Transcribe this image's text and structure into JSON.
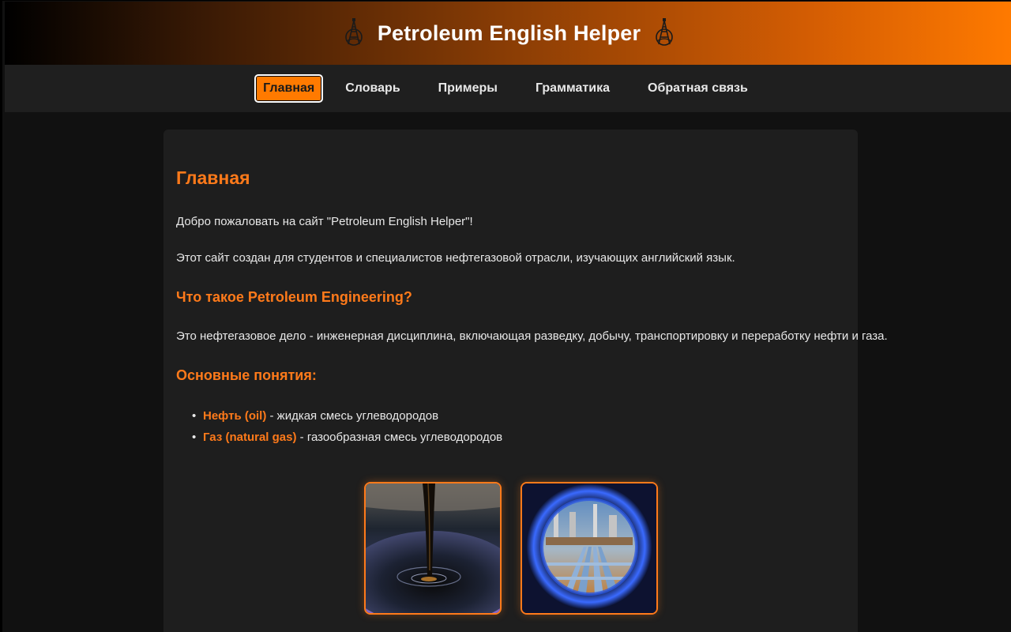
{
  "header": {
    "title": "Petroleum English Helper",
    "left_icon": "oil-rig-icon",
    "right_icon": "oil-rig-icon"
  },
  "nav": {
    "items": [
      {
        "label": "Главная",
        "active": true
      },
      {
        "label": "Словарь",
        "active": false
      },
      {
        "label": "Примеры",
        "active": false
      },
      {
        "label": "Грамматика",
        "active": false
      },
      {
        "label": "Обратная связь",
        "active": false
      }
    ]
  },
  "main": {
    "heading": "Главная",
    "welcome": "Добро пожаловать на сайт \"Petroleum English Helper\"!",
    "intro": "Этот сайт создан для студентов и специалистов нефтегазовой отрасли, изучающих английский язык.",
    "what_is_heading": "Что такое Petroleum Engineering?",
    "what_is_text": "Это нефтегазовое дело - инженерная дисциплина, включающая разведку, добычу, транспортировку и переработку нефти и газа.",
    "concepts_heading": "Основные понятия:",
    "concepts": [
      {
        "term": "Нефть (oil)",
        "definition": " - жидкая смесь углеводородов"
      },
      {
        "term": "Газ (natural gas)",
        "definition": " - газообразная смесь углеводородов"
      }
    ],
    "images": [
      {
        "name": "oil-image"
      },
      {
        "name": "gas-image"
      }
    ]
  },
  "colors": {
    "accent": "#ff7a1a",
    "active_nav_bg": "#ff7a00",
    "page_bg": "#111111",
    "panel_bg": "#1e1e1e",
    "nav_bg": "#1f1f1f"
  }
}
